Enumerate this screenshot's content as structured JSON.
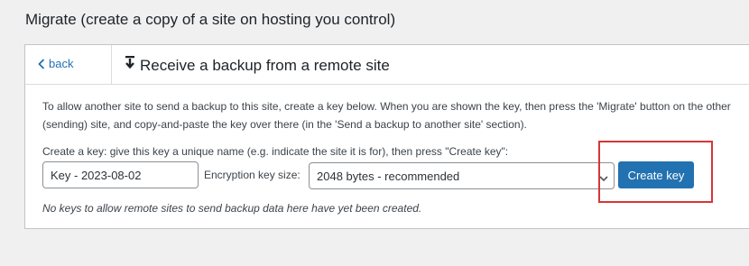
{
  "page": {
    "heading": "Migrate (create a copy of a site on hosting you control)"
  },
  "panel": {
    "back_label": "back",
    "title": "Receive a backup from a remote site",
    "intro": "To allow another site to send a backup to this site, create a key below. When you are shown the key, then press the 'Migrate' button on the other (sending) site, and copy-and-paste the key over there (in the 'Send a backup to another site' section).",
    "create_label": "Create a key: give this key a unique name (e.g. indicate the site it is for), then press \"Create key\":",
    "key_name_value": "Key - 2023-08-02",
    "size_label": "Encryption key size:",
    "size_selected": "2048 bytes - recommended",
    "create_button": "Create key",
    "no_keys_text": "No keys to allow remote sites to send backup data here have yet been created."
  },
  "colors": {
    "accent": "#2271b1",
    "highlight": "#d63638",
    "background": "#f0f0f1"
  },
  "icons": {
    "back": "chevron-left-icon",
    "title": "download-arrow-icon",
    "select": "chevron-down-icon"
  }
}
